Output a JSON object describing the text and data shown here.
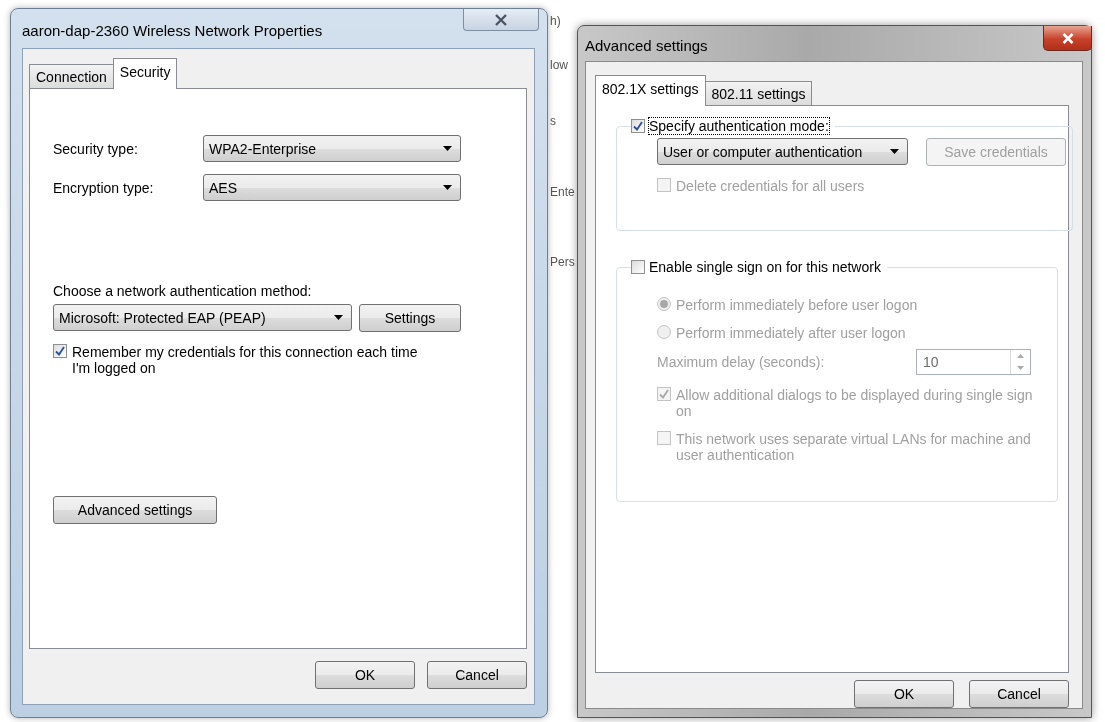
{
  "properties_dialog": {
    "title": "aaron-dap-2360 Wireless Network Properties",
    "tabs": [
      {
        "label": "Connection",
        "selected": false
      },
      {
        "label": "Security",
        "selected": true
      }
    ],
    "security_type": {
      "label": "Security type:",
      "value": "WPA2-Enterprise"
    },
    "encryption_type": {
      "label": "Encryption type:",
      "value": "AES"
    },
    "auth_method": {
      "label": "Choose a network authentication method:",
      "value": "Microsoft: Protected EAP (PEAP)"
    },
    "settings_button": "Settings",
    "remember": {
      "label": "Remember my credentials for this connection each time I'm logged on",
      "checked": true
    },
    "advanced_button": "Advanced settings",
    "buttons": [
      "OK",
      "Cancel"
    ]
  },
  "background_window": {
    "fragments": [
      "h)",
      "low",
      "s",
      "Ente",
      "Pers"
    ]
  },
  "advanced_dialog": {
    "title": "Advanced settings",
    "tabs": [
      {
        "label": "802.1X settings",
        "selected": true
      },
      {
        "label": "802.11 settings",
        "selected": false
      }
    ],
    "auth_group": {
      "label": "Specify authentication mode:",
      "checked": true,
      "mode": "User or computer authentication",
      "save_button": {
        "label": "Save credentials",
        "disabled": true
      },
      "delete": {
        "label": "Delete credentials for all users",
        "checked": false,
        "disabled": true
      }
    },
    "sso_group": {
      "label": "Enable single sign on for this network",
      "checked": false,
      "options": [
        {
          "label": "Perform immediately before user logon",
          "selected": true,
          "disabled": true
        },
        {
          "label": "Perform immediately after user logon",
          "selected": false,
          "disabled": true
        }
      ],
      "delay": {
        "label": "Maximum delay (seconds):",
        "value": "10",
        "disabled": true
      },
      "checkboxes": [
        {
          "label": "Allow additional dialogs to be displayed during single sign on",
          "checked": true,
          "disabled": true
        },
        {
          "label": "This network uses separate virtual LANs for machine and user authentication",
          "checked": false,
          "disabled": true
        }
      ]
    },
    "buttons": [
      "OK",
      "Cancel"
    ]
  }
}
